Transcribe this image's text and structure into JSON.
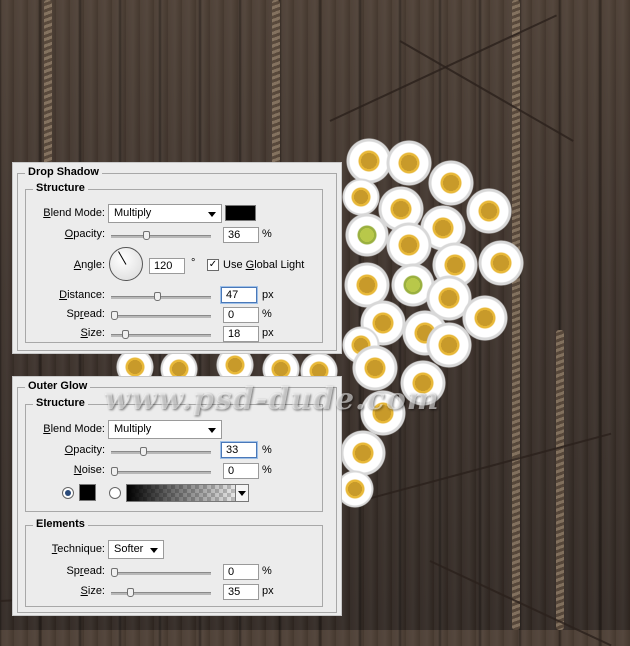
{
  "drop_shadow": {
    "title": "Drop Shadow",
    "structure_title": "Structure",
    "blend_mode": {
      "label_pre": "",
      "label_u": "B",
      "label_post": "lend Mode:",
      "value": "Multiply"
    },
    "opacity": {
      "label_pre": "",
      "label_u": "O",
      "label_post": "pacity:",
      "value": "36",
      "unit": "%"
    },
    "angle": {
      "label_pre": "",
      "label_u": "A",
      "label_post": "ngle:",
      "value": "120",
      "unit": "°"
    },
    "global_light": {
      "label_pre": "Use ",
      "label_u": "G",
      "label_post": "lobal Light",
      "checked": true
    },
    "distance": {
      "label_pre": "",
      "label_u": "D",
      "label_post": "istance:",
      "value": "47",
      "unit": "px"
    },
    "spread": {
      "label_pre": "Sp",
      "label_u": "r",
      "label_post": "ead:",
      "value": "0",
      "unit": "%"
    },
    "size": {
      "label_pre": "",
      "label_u": "S",
      "label_post": "ize:",
      "value": "18",
      "unit": "px"
    }
  },
  "outer_glow": {
    "title": "Outer Glow",
    "structure_title": "Structure",
    "blend_mode": {
      "label_pre": "",
      "label_u": "B",
      "label_post": "lend Mode:",
      "value": "Multiply"
    },
    "opacity": {
      "label_pre": "",
      "label_u": "O",
      "label_post": "pacity:",
      "value": "33",
      "unit": "%"
    },
    "noise": {
      "label_pre": "",
      "label_u": "N",
      "label_post": "oise:",
      "value": "0",
      "unit": "%"
    },
    "elements_title": "Elements",
    "technique": {
      "label_pre": "",
      "label_u": "T",
      "label_post": "echnique:",
      "value": "Softer"
    },
    "spread": {
      "label_pre": "Sp",
      "label_u": "r",
      "label_post": "ead:",
      "value": "0",
      "unit": "%"
    },
    "size": {
      "label_pre": "",
      "label_u": "S",
      "label_post": "ize:",
      "value": "35",
      "unit": "px"
    }
  },
  "watermark": "www.psd-dude.com",
  "colors": {
    "panel_bg": "#ececec",
    "shadow_color": "#000000",
    "glow_color": "#000000",
    "focus_border": "#4a78b8"
  }
}
